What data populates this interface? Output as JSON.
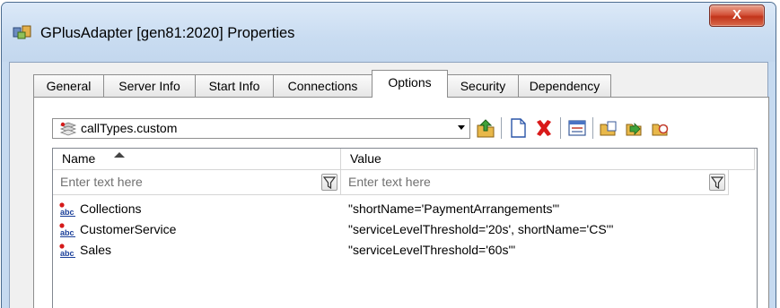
{
  "window": {
    "title": "GPlusAdapter [gen81:2020] Properties",
    "close_label": "X"
  },
  "tabs": [
    {
      "label": "General",
      "active": false
    },
    {
      "label": "Server Info",
      "active": false
    },
    {
      "label": "Start Info",
      "active": false
    },
    {
      "label": "Connections",
      "active": false
    },
    {
      "label": "Options",
      "active": true
    },
    {
      "label": "Security",
      "active": false
    },
    {
      "label": "Dependency",
      "active": false
    }
  ],
  "section_combo": {
    "selected": "callTypes.custom"
  },
  "toolbar": {
    "icons": [
      "up-folder-icon",
      "new-document-icon",
      "delete-icon",
      "edit-list-icon",
      "copy-icon",
      "import-icon",
      "export-icon"
    ]
  },
  "grid": {
    "columns": [
      {
        "label": "Name",
        "sorted": "ascending"
      },
      {
        "label": "Value"
      }
    ],
    "filter_placeholder_name": "Enter text here",
    "filter_placeholder_value": "Enter text here",
    "rows": [
      {
        "name": "Collections",
        "value": "\"shortName='PaymentArrangements'\""
      },
      {
        "name": "CustomerService",
        "value": "\"serviceLevelThreshold='20s', shortName='CS'\""
      },
      {
        "name": "Sales",
        "value": "\"serviceLevelThreshold='60s'\""
      }
    ]
  },
  "colors": {
    "titlebar": "#c9dcf1",
    "close_button": "#c2341a",
    "delete_icon": "#d91a1a"
  }
}
